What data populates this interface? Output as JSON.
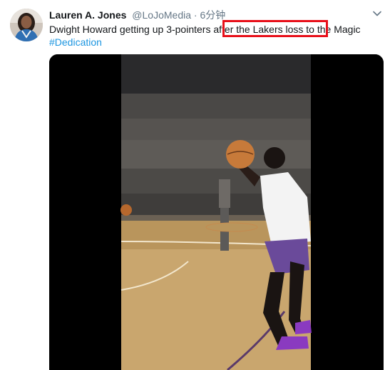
{
  "tweet": {
    "author": {
      "display_name": "Lauren A. Jones",
      "handle": "@LoJoMedia",
      "avatar": "avatar-icon"
    },
    "separator": " · ",
    "timestamp": "6分钟",
    "text": {
      "part1": "Dwight Howard getting up 3-pointers after the Lakers loss to the Magic ",
      "hashtag": "#Dedication"
    },
    "menu_icon": "chevron-down-icon",
    "media": {
      "type": "video",
      "description_icon": "basketball-video-icon"
    }
  },
  "colors": {
    "hashtag": "#1b95e0",
    "secondary_text": "#657786",
    "highlight_box": "#e8101a",
    "video_background": "#000000"
  }
}
